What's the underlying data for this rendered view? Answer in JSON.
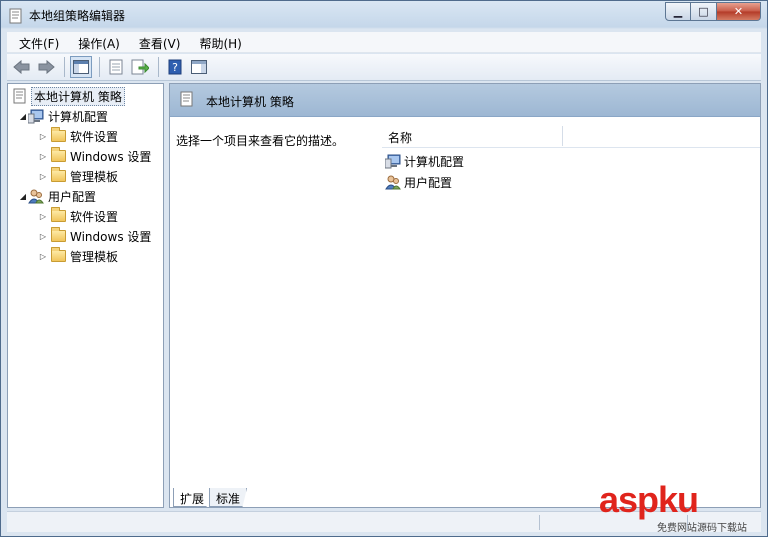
{
  "window": {
    "title": "本地组策略编辑器",
    "minimize_icon": "minimize-icon",
    "maximize_icon": "maximize-icon",
    "close_icon": "close-icon"
  },
  "menu": {
    "items": [
      {
        "label": "文件(F)"
      },
      {
        "label": "操作(A)"
      },
      {
        "label": "查看(V)"
      },
      {
        "label": "帮助(H)"
      }
    ]
  },
  "toolbar": {
    "buttons": [
      {
        "icon": "back-arrow-icon"
      },
      {
        "icon": "forward-arrow-icon"
      },
      {
        "icon": "show-hide-console-tree-icon"
      },
      {
        "icon": "properties-icon"
      },
      {
        "icon": "export-list-icon"
      },
      {
        "icon": "help-icon"
      },
      {
        "icon": "show-hide-action-pane-icon"
      }
    ]
  },
  "tree": {
    "root": "本地计算机 策略",
    "computer_config": {
      "label": "计算机配置",
      "children": [
        "软件设置",
        "Windows 设置",
        "管理模板"
      ]
    },
    "user_config": {
      "label": "用户配置",
      "children": [
        "软件设置",
        "Windows 设置",
        "管理模板"
      ]
    }
  },
  "details": {
    "header": "本地计算机 策略",
    "description": "选择一个项目来查看它的描述。",
    "column_name": "名称",
    "items": [
      "计算机配置",
      "用户配置"
    ]
  },
  "tabs": {
    "extended": "扩展",
    "standard": "标准"
  },
  "watermark": {
    "brand": "aspku",
    "sub": "免费网站源码下载站"
  }
}
